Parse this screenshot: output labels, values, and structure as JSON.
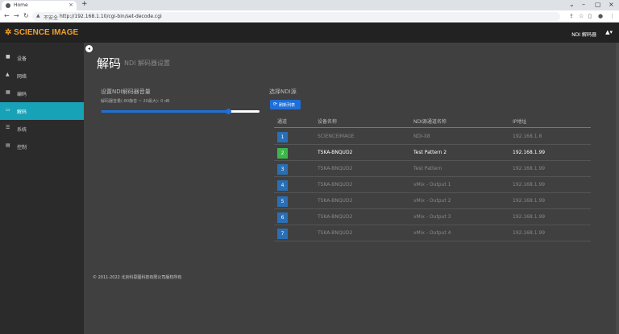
{
  "browser": {
    "tab_title": "Home",
    "insecure_label": "不安全",
    "url": "http://192.168.1.10/cgi-bin/set-decode.cgi"
  },
  "header": {
    "logo": "✲ SCIENCE IMAGE",
    "user_name": "NDI 解码器"
  },
  "sidebar": {
    "items": [
      {
        "label": "设备",
        "icon": "car-icon"
      },
      {
        "label": "网络",
        "icon": "sitemap-icon"
      },
      {
        "label": "编码",
        "icon": "chart-icon"
      },
      {
        "label": "解码",
        "icon": "monitor-icon",
        "active": true
      },
      {
        "label": "系统",
        "icon": "list-icon"
      },
      {
        "label": "控制",
        "icon": "grid-icon"
      }
    ]
  },
  "main": {
    "title": "解码",
    "subtitle": "NDI 解码器设置",
    "volume": {
      "label": "设置NDI解码器音量",
      "range_text": "解码器音量(-80静音 ~ 20最大):  0 dB",
      "value_fraction": 0.8
    },
    "select": {
      "label": "选择NDI源",
      "refresh_label": "刷新列表"
    },
    "table": {
      "headers": [
        "通道",
        "设备名称",
        "NDI源通道名称",
        "IP地址"
      ],
      "rows": [
        {
          "num": "1",
          "device": "SCIENCEIMAGE",
          "source": "NDI-X8",
          "ip": "192.168.1.8",
          "selected": false
        },
        {
          "num": "2",
          "device": "TSKA-BNQUD2",
          "source": "Test Pattern 2",
          "ip": "192.168.1.99",
          "selected": true
        },
        {
          "num": "3",
          "device": "TSKA-BNQUD2",
          "source": "Test Pattern",
          "ip": "192.168.1.99",
          "selected": false
        },
        {
          "num": "4",
          "device": "TSKA-BNQUD2",
          "source": "vMix - Output 1",
          "ip": "192.168.1.99",
          "selected": false
        },
        {
          "num": "5",
          "device": "TSKA-BNQUD2",
          "source": "vMix - Output 2",
          "ip": "192.168.1.99",
          "selected": false
        },
        {
          "num": "6",
          "device": "TSKA-BNQUD2",
          "source": "vMix - Output 3",
          "ip": "192.168.1.99",
          "selected": false
        },
        {
          "num": "7",
          "device": "TSKA-BNQUD2",
          "source": "vMix - Output 4",
          "ip": "192.168.1.99",
          "selected": false
        }
      ]
    },
    "footer": "© 2011-2022 北京科思图科技有限公司版权所有"
  },
  "colors": {
    "accent": "#17a2b8",
    "primary": "#1e6fd9",
    "selected": "#3cb64a",
    "logo": "#f0a030"
  }
}
